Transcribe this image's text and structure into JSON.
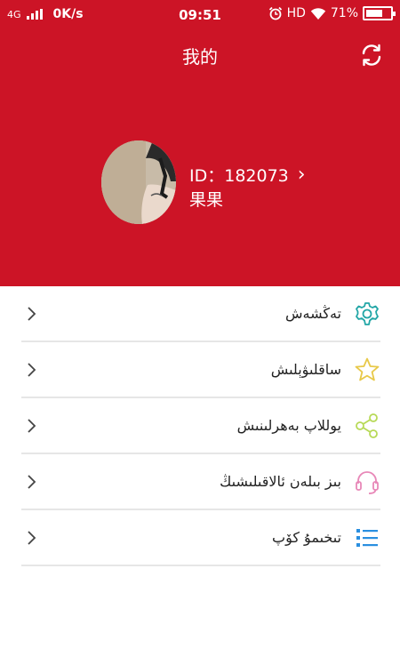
{
  "status_bar": {
    "network": "4G",
    "speed": "0K/s",
    "time": "09:51",
    "hd": "HD",
    "battery_text": "71%",
    "battery_level": 0.71
  },
  "header": {
    "title": "我的",
    "background": "#cc1426"
  },
  "profile": {
    "id_text": "ID：182073",
    "name": "果果"
  },
  "menu": {
    "items": [
      {
        "label": "تەڭشەش",
        "icon": "gear-icon",
        "color": "#22a6a6"
      },
      {
        "label": "ساقلىۋېلىش",
        "icon": "star-icon",
        "color": "#e8c94a"
      },
      {
        "label": "يوللاپ بەھرلىنىش",
        "icon": "share-icon",
        "color": "#b7d957"
      },
      {
        "label": "بىز بىلەن ئالاقىلىشىڭ",
        "icon": "headset-icon",
        "color": "#e888b8"
      },
      {
        "label": "تىخىمۇ كۆپ",
        "icon": "list-icon",
        "color": "#2a8fe0"
      }
    ]
  }
}
